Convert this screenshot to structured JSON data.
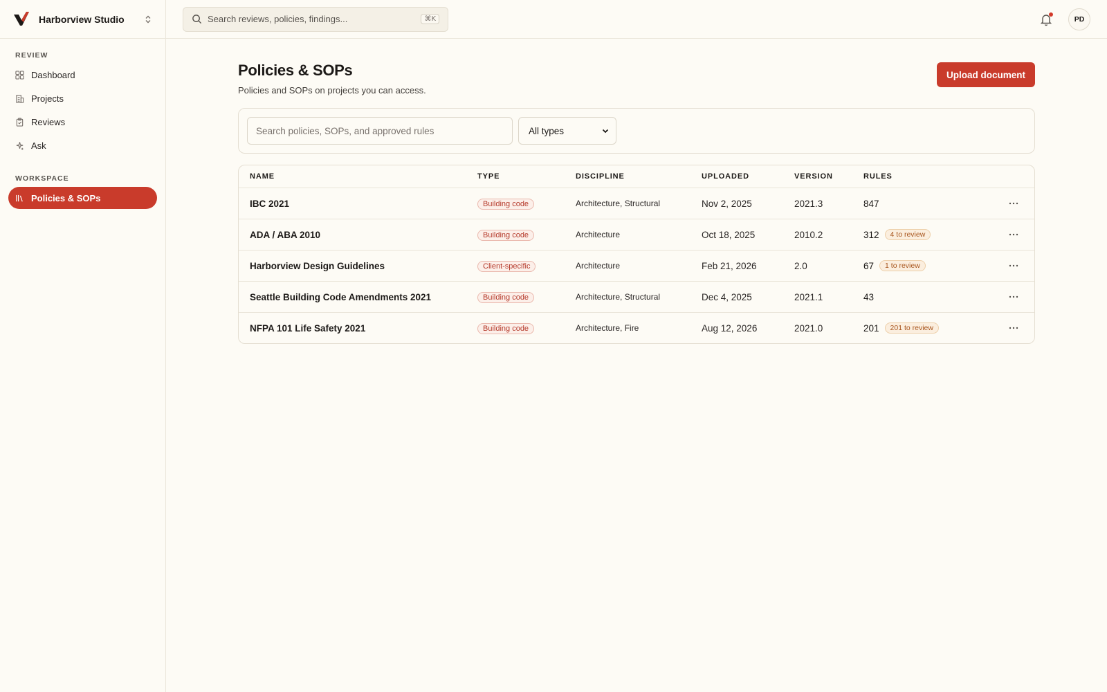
{
  "workspace": {
    "name": "Harborview Studio"
  },
  "topbar": {
    "search_placeholder": "Search reviews, policies, findings...",
    "shortcut": "⌘K",
    "user_initials": "PD"
  },
  "sidebar": {
    "review_heading": "REVIEW",
    "review_items": [
      {
        "label": "Dashboard",
        "icon": "grid-icon"
      },
      {
        "label": "Projects",
        "icon": "building-icon"
      },
      {
        "label": "Reviews",
        "icon": "clipboard-icon"
      },
      {
        "label": "Ask",
        "icon": "sparkle-icon"
      }
    ],
    "workspace_heading": "WORKSPACE",
    "workspace_items": [
      {
        "label": "Policies & SOPs",
        "icon": "library-icon",
        "active": true
      }
    ]
  },
  "page": {
    "title": "Policies & SOPs",
    "subtitle": "Policies and SOPs on projects you can access.",
    "upload_label": "Upload document",
    "filter_placeholder": "Search policies, SOPs, and approved rules",
    "type_filter_value": "All types"
  },
  "table": {
    "columns": [
      "NAME",
      "TYPE",
      "DISCIPLINE",
      "UPLOADED",
      "VERSION",
      "RULES"
    ],
    "rows": [
      {
        "name": "IBC 2021",
        "type": "Building code",
        "discipline": "Architecture, Structural",
        "uploaded": "Nov 2, 2025",
        "version": "2021.3",
        "rules": "847",
        "review": ""
      },
      {
        "name": "ADA / ABA 2010",
        "type": "Building code",
        "discipline": "Architecture",
        "uploaded": "Oct 18, 2025",
        "version": "2010.2",
        "rules": "312",
        "review": "4 to review"
      },
      {
        "name": "Harborview Design Guidelines",
        "type": "Client-specific",
        "discipline": "Architecture",
        "uploaded": "Feb 21, 2026",
        "version": "2.0",
        "rules": "67",
        "review": "1 to review"
      },
      {
        "name": "Seattle Building Code Amendments 2021",
        "type": "Building code",
        "discipline": "Architecture, Structural",
        "uploaded": "Dec 4, 2025",
        "version": "2021.1",
        "rules": "43",
        "review": ""
      },
      {
        "name": "NFPA 101 Life Safety 2021",
        "type": "Building code",
        "discipline": "Architecture, Fire",
        "uploaded": "Aug 12, 2026",
        "version": "2021.0",
        "rules": "201",
        "review": "201 to review"
      }
    ]
  },
  "colors": {
    "accent": "#c93b2b",
    "background": "#fdfbf5",
    "review_badge": "#a8561e"
  }
}
